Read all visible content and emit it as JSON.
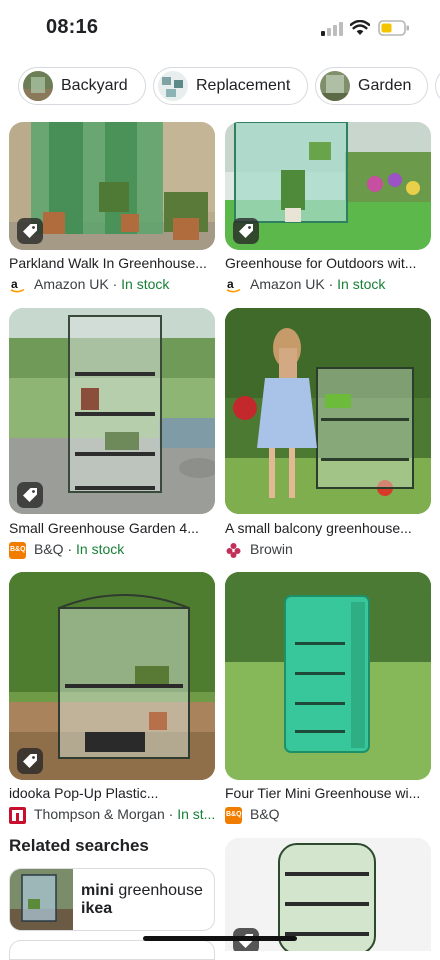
{
  "status_bar": {
    "time": "08:16"
  },
  "chips": [
    {
      "label": "Backyard"
    },
    {
      "label": "Replacement"
    },
    {
      "label": "Garden"
    }
  ],
  "results": [
    {
      "title": "Parkland Walk In Greenhouse...",
      "source": "Amazon UK",
      "stock": "In stock"
    },
    {
      "title": "Greenhouse for Outdoors wit...",
      "source": "Amazon UK",
      "stock": "In stock"
    },
    {
      "title": "Small Greenhouse Garden 4...",
      "source": "B&Q",
      "stock": "In stock"
    },
    {
      "title": "A small balcony greenhouse...",
      "source": "Browin",
      "stock": ""
    },
    {
      "title": "idooka Pop-Up Plastic...",
      "source": "Thompson & Morgan",
      "stock": "In st..."
    },
    {
      "title": "Four Tier Mini Greenhouse wi...",
      "source": "B&Q",
      "stock": ""
    }
  ],
  "stock_separator": " · ",
  "logos": {
    "bq": "B&Q"
  },
  "related": {
    "title": "Related searches",
    "items": [
      {
        "bold": "mini",
        "rest": " greenhouse",
        "bold2": "ikea"
      }
    ]
  },
  "colors": {
    "in_stock": "#188038",
    "bq_orange": "#f07d00",
    "amazon_orange": "#ff9900"
  }
}
